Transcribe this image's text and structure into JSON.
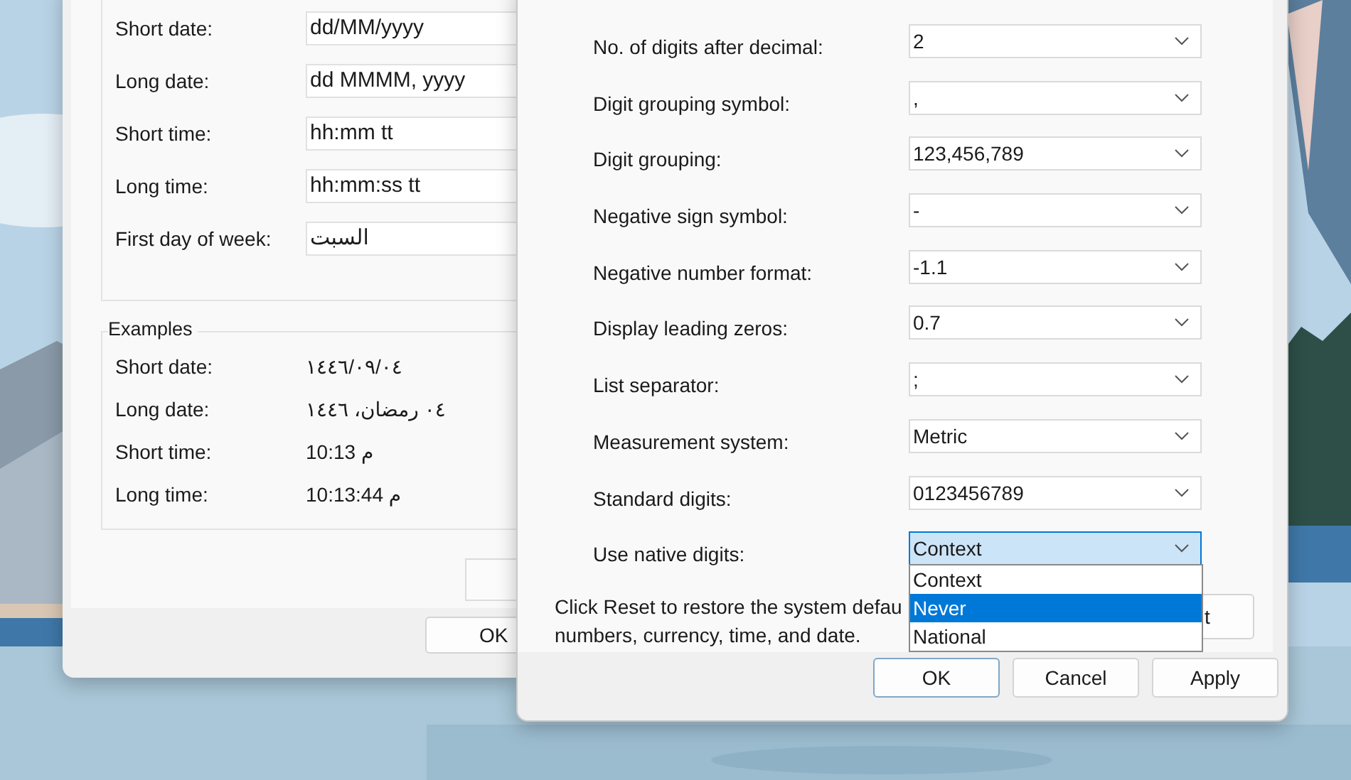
{
  "back_window": {
    "format_rows": [
      {
        "label": "Short date:",
        "value": "dd/MM/yyyy"
      },
      {
        "label": "Long date:",
        "value": "dd MMMM, yyyy"
      },
      {
        "label": "Short time:",
        "value": "hh:mm tt"
      },
      {
        "label": "Long time:",
        "value": "hh:mm:ss tt"
      },
      {
        "label": "First day of week:",
        "value": "السبت"
      }
    ],
    "examples_title": "Examples",
    "examples": [
      {
        "label": "Short date:",
        "value": "١٤٤٦/٠٩/٠٤"
      },
      {
        "label": "Long date:",
        "value": "٠٤ رمضان، ١٤٤٦"
      },
      {
        "label": "Short time:",
        "value": "10:13 م"
      },
      {
        "label": "Long time:",
        "value": "10:13:44 م"
      }
    ],
    "ok_button": "OK"
  },
  "front_window": {
    "settings": [
      {
        "label": "No. of digits after decimal:",
        "value": "2",
        "focused": false
      },
      {
        "label": "Digit grouping symbol:",
        "value": ",",
        "focused": false
      },
      {
        "label": "Digit grouping:",
        "value": "123,456,789",
        "focused": false
      },
      {
        "label": "Negative sign symbol:",
        "value": "-",
        "focused": false
      },
      {
        "label": "Negative number format:",
        "value": "-1.1",
        "focused": false
      },
      {
        "label": "Display leading zeros:",
        "value": "0.7",
        "focused": false
      },
      {
        "label": "List separator:",
        "value": ";",
        "focused": false
      },
      {
        "label": "Measurement system:",
        "value": "Metric",
        "focused": false
      },
      {
        "label": "Standard digits:",
        "value": "0123456789",
        "focused": false
      },
      {
        "label": "Use native digits:",
        "value": "Context",
        "focused": true
      }
    ],
    "dropdown_options": [
      {
        "label": "Context",
        "selected": false
      },
      {
        "label": "Never",
        "selected": true
      },
      {
        "label": "National",
        "selected": false
      }
    ],
    "reset_note": [
      "Click Reset to restore the system defau",
      "numbers, currency, time, and date."
    ],
    "reset_button": "t",
    "buttons": [
      {
        "label": "OK",
        "default": true
      },
      {
        "label": "Cancel",
        "default": false
      },
      {
        "label": "Apply",
        "default": false
      }
    ]
  }
}
